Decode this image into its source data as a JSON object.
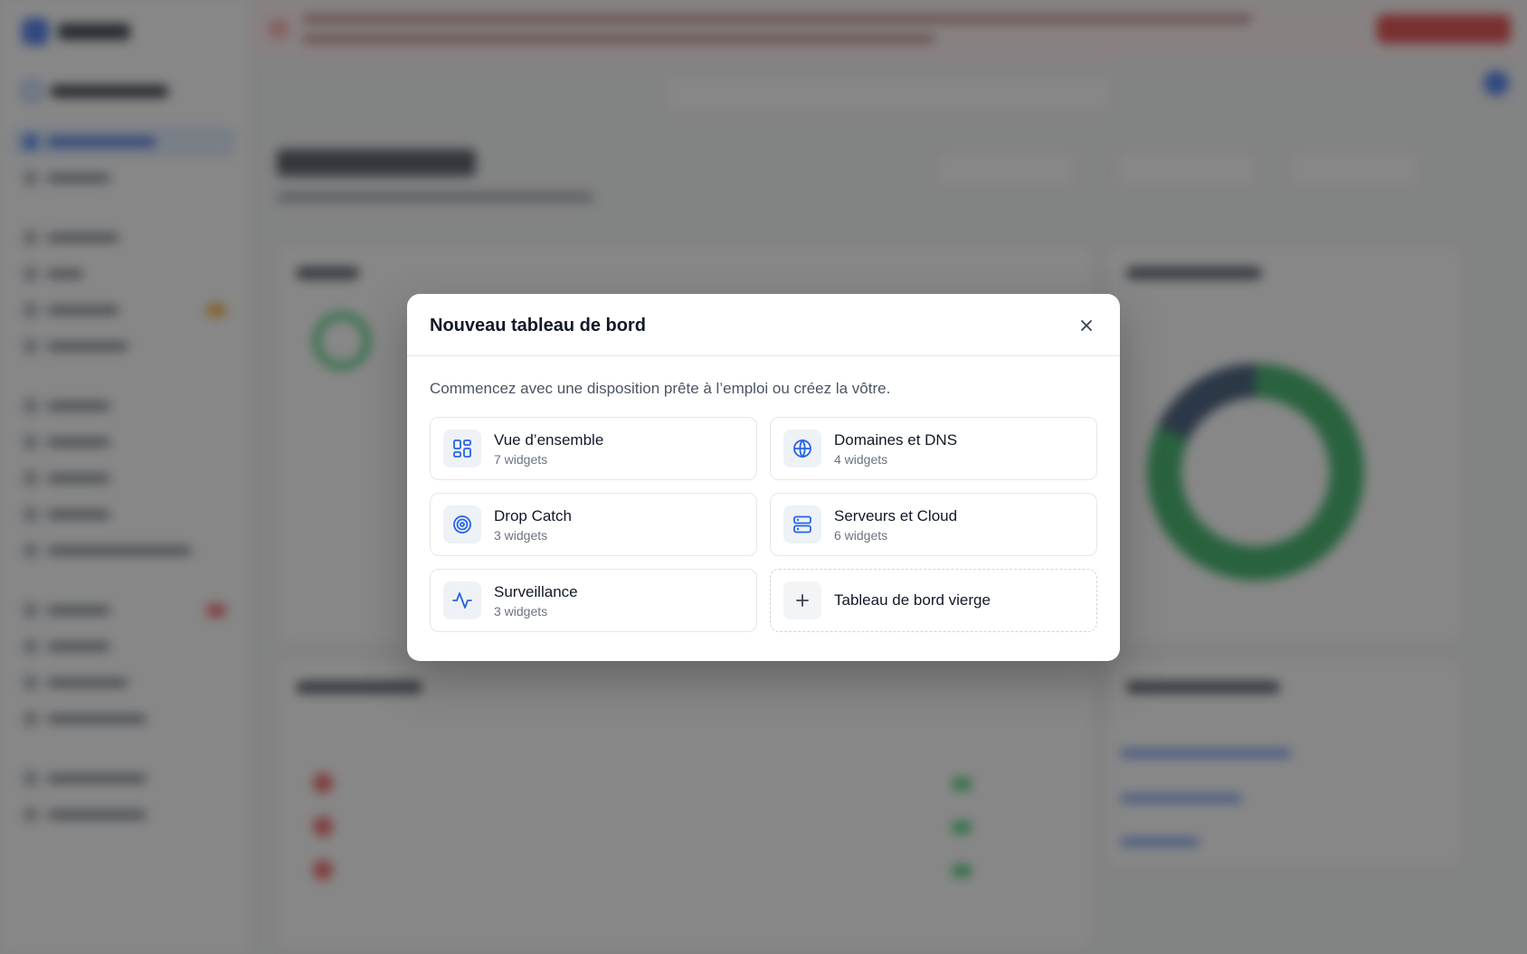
{
  "modal": {
    "title": "Nouveau tableau de bord",
    "description": "Commencez avec une disposition prête à l’emploi ou créez la vôtre.",
    "templates": [
      {
        "name": "Vue d’ensemble",
        "count": "7 widgets",
        "icon": "layout-dashboard-icon"
      },
      {
        "name": "Domaines et DNS",
        "count": "4 widgets",
        "icon": "globe-icon"
      },
      {
        "name": "Drop Catch",
        "count": "3 widgets",
        "icon": "target-icon"
      },
      {
        "name": "Serveurs et Cloud",
        "count": "6 widgets",
        "icon": "server-icon"
      },
      {
        "name": "Surveillance",
        "count": "3 widgets",
        "icon": "activity-icon"
      },
      {
        "name": "Tableau de bord vierge",
        "icon": "plus-icon"
      }
    ]
  },
  "colors": {
    "accent": "#2563eb",
    "overlay": "rgba(55,55,55,0.6)",
    "icon_tile": "#eef2f7"
  }
}
